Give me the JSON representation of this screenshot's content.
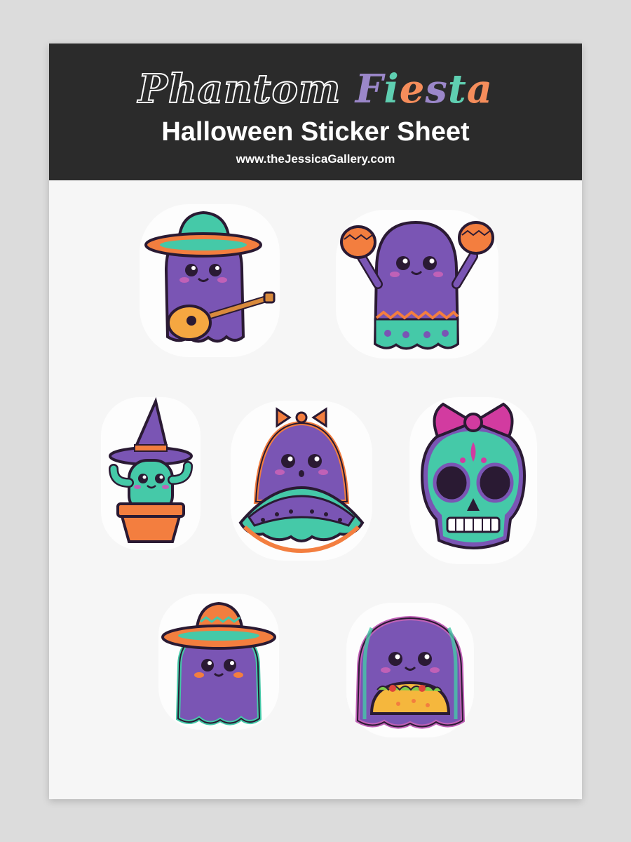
{
  "sheet": {
    "title_word_1": "Phantom",
    "title_word_2_letters": [
      "F",
      "i",
      "e",
      "s",
      "t",
      "a"
    ],
    "title_word_2_colors": [
      "#9b87c9",
      "#5fcfb1",
      "#f58d5b",
      "#9b87c9",
      "#5fcfb1",
      "#f58d5b"
    ],
    "subtitle": "Halloween Sticker Sheet",
    "url": "www.theJessicaGallery.com"
  },
  "colors": {
    "purple": "#7a55b4",
    "teal": "#45c9a8",
    "orange": "#f37e3f",
    "pink": "#d23ba0",
    "outline": "#2a1a33",
    "header_bg": "#2b2b2b",
    "sheet_bg": "#f6f6f6"
  },
  "stickers": [
    {
      "name": "mariachi-ghost-guitar-sticker"
    },
    {
      "name": "maracas-ghost-sticker"
    },
    {
      "name": "witch-cactus-sticker"
    },
    {
      "name": "bow-dress-ghost-sticker"
    },
    {
      "name": "sugar-skull-bow-sticker"
    },
    {
      "name": "sombrero-ghost-sticker"
    },
    {
      "name": "taco-ghost-sticker"
    }
  ]
}
